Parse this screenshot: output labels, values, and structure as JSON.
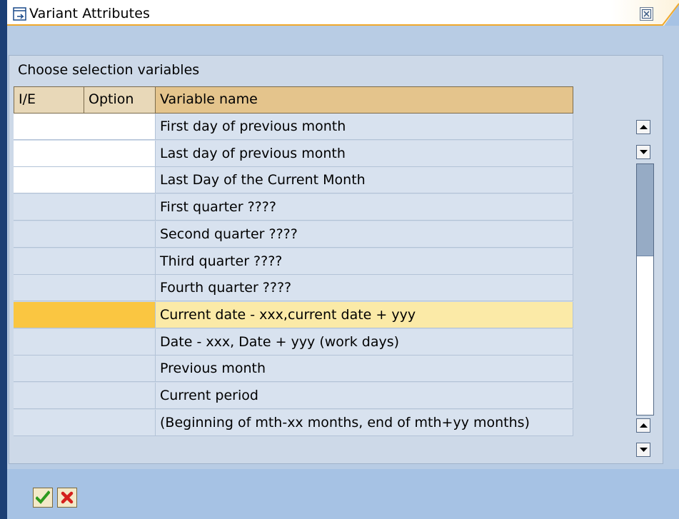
{
  "window": {
    "title": "Variant Attributes"
  },
  "caption": "Choose selection variables",
  "columns": {
    "ie": "I/E",
    "option": "Option",
    "variable": "Variable name"
  },
  "rows": [
    {
      "ie": "",
      "option": "",
      "variable": "First day of previous month"
    },
    {
      "ie": "",
      "option": "",
      "variable": "Last day of previous month"
    },
    {
      "ie": "",
      "option": "",
      "variable": "Last Day of the Current Month"
    },
    {
      "ie": "",
      "option": "",
      "variable": "First quarter ????"
    },
    {
      "ie": "",
      "option": "",
      "variable": "Second quarter ????"
    },
    {
      "ie": "",
      "option": "",
      "variable": "Third quarter ????"
    },
    {
      "ie": "",
      "option": "",
      "variable": "Fourth quarter ????"
    },
    {
      "ie": "",
      "option": "",
      "variable": "Current date - xxx,current date + yyy"
    },
    {
      "ie": "",
      "option": "",
      "variable": "Date - xxx, Date + yyy (work days)"
    },
    {
      "ie": "",
      "option": "",
      "variable": "Previous month"
    },
    {
      "ie": "",
      "option": "",
      "variable": "Current period"
    },
    {
      "ie": "",
      "option": "",
      "variable": "(Beginning of mth-xx months, end of mth+yy months)"
    }
  ],
  "selected_row_index": 7,
  "icons": {
    "title": "window-icon",
    "close": "close-icon",
    "scroll_up": "arrow-up-icon",
    "scroll_down": "arrow-down-icon",
    "confirm": "checkmark-icon",
    "cancel": "cancel-x-icon"
  },
  "colors": {
    "highlight": "#fac641",
    "highlight_name": "#fbeaa7",
    "header": "#e8d8b8",
    "confirm": "#2e9a1e",
    "cancel": "#d4201c"
  }
}
